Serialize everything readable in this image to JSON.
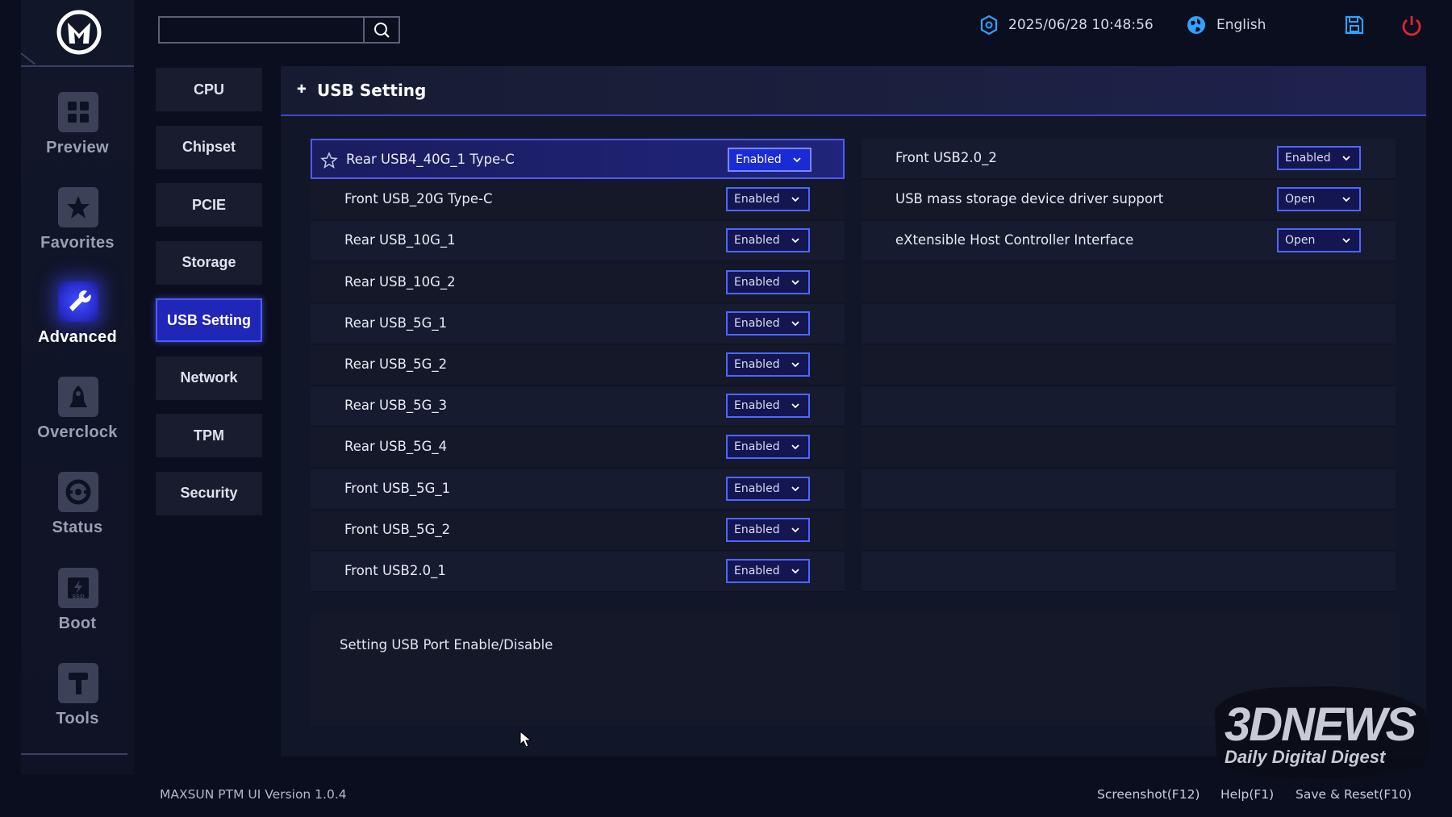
{
  "header": {
    "datetime": "2025/06/28 10:48:56",
    "language": "English",
    "search_placeholder": ""
  },
  "nav": [
    {
      "label": "Preview",
      "icon": "grid-icon"
    },
    {
      "label": "Favorites",
      "icon": "star-icon"
    },
    {
      "label": "Advanced",
      "icon": "wrench-icon",
      "active": true
    },
    {
      "label": "Overclock",
      "icon": "rocket-icon"
    },
    {
      "label": "Status",
      "icon": "gauge-icon"
    },
    {
      "label": "Boot",
      "icon": "ssd-icon"
    },
    {
      "label": "Tools",
      "icon": "hammer-icon"
    }
  ],
  "submenu": [
    {
      "label": "CPU"
    },
    {
      "label": "Chipset"
    },
    {
      "label": "PCIE"
    },
    {
      "label": "Storage"
    },
    {
      "label": "USB Setting",
      "active": true
    },
    {
      "label": "Network"
    },
    {
      "label": "TPM"
    },
    {
      "label": "Security"
    }
  ],
  "panel": {
    "title": "USB Setting",
    "left_settings": [
      {
        "label": "Rear USB4_40G_1 Type-C",
        "value": "Enabled"
      },
      {
        "label": "Front USB_20G Type-C",
        "value": "Enabled"
      },
      {
        "label": "Rear USB_10G_1",
        "value": "Enabled"
      },
      {
        "label": "Rear USB_10G_2",
        "value": "Enabled"
      },
      {
        "label": "Rear USB_5G_1",
        "value": "Enabled"
      },
      {
        "label": "Rear USB_5G_2",
        "value": "Enabled"
      },
      {
        "label": "Rear USB_5G_3",
        "value": "Enabled"
      },
      {
        "label": "Rear USB_5G_4",
        "value": "Enabled"
      },
      {
        "label": "Front USB_5G_1",
        "value": "Enabled"
      },
      {
        "label": "Front USB_5G_2",
        "value": "Enabled"
      },
      {
        "label": "Front USB2.0_1",
        "value": "Enabled"
      }
    ],
    "right_settings": [
      {
        "label": "Front USB2.0_2",
        "value": "Enabled"
      },
      {
        "label": "USB mass storage device driver support",
        "value": "Open"
      },
      {
        "label": "eXtensible Host Controller Interface",
        "value": "Open"
      }
    ],
    "help_text": "Setting USB Port Enable/Disable"
  },
  "footer": {
    "version": "MAXSUN PTM UI Version 1.0.4",
    "screenshot": "Screenshot(F12)",
    "help": "Help(F1)",
    "save_reset": "Save & Reset(F10)"
  },
  "watermark": {
    "brand": "3DNEWS",
    "tagline": "Daily Digital Digest"
  },
  "colors": {
    "accent": "#4e67ff",
    "active_bg": "#1f26b8",
    "power": "#e0262f",
    "header_icon": "#2fa3ff"
  }
}
